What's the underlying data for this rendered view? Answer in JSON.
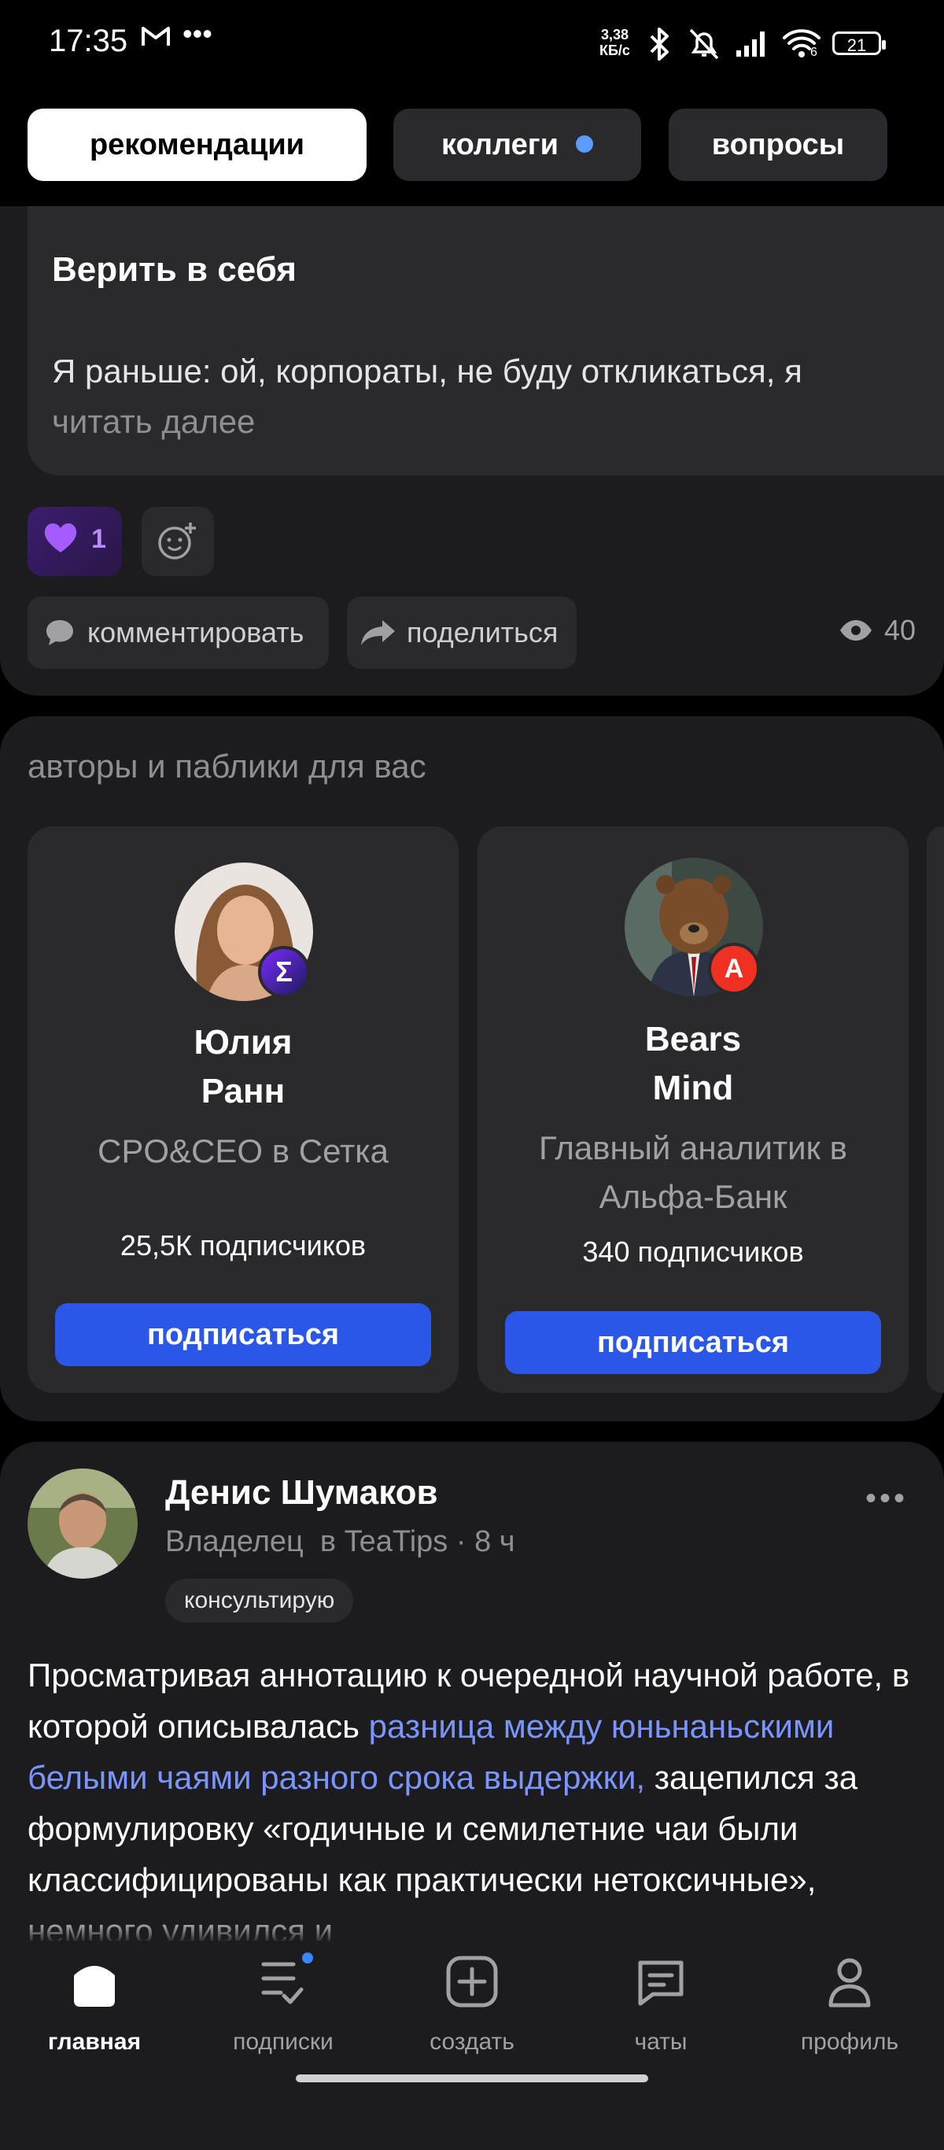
{
  "status_bar": {
    "time": "17:35",
    "net_speed_value": "3,38",
    "net_speed_unit": "КБ/с",
    "battery": "21",
    "signal_label": "6"
  },
  "tabs": [
    {
      "label": "рекомендации",
      "active": true
    },
    {
      "label": "коллеги",
      "has_dot": true
    },
    {
      "label": "вопросы"
    }
  ],
  "post1": {
    "title": "Верить в себя",
    "text": "Я раньше: ой, корпораты, не буду откликаться, я",
    "read_more": "читать далее",
    "reaction_count": "1",
    "comment_label": "комментировать",
    "share_label": "поделиться",
    "views": "40"
  },
  "authors": {
    "section_title": "авторы и паблики для вас",
    "cards": [
      {
        "name_line1": "Юлия",
        "name_line2": "Ранн",
        "role_line1": "CPO&CEO в Сетка",
        "role_line2": "",
        "subscribers": "25,5К подписчиков",
        "button": "подписаться",
        "badge": "Σ"
      },
      {
        "name_line1": "Bears",
        "name_line2": "Mind",
        "role_line1": "Главный аналитик в",
        "role_line2": "Альфа-Банк",
        "subscribers": "340 подписчиков",
        "button": "подписаться",
        "badge": "А"
      }
    ]
  },
  "post2": {
    "author": "Денис Шумаков",
    "role": "Владелец",
    "company": "в TeaTips",
    "time": "· 8 ч",
    "tag": "консультирую",
    "text_before_link": "Просматривая аннотацию к очередной научной работе, в которой описывалась ",
    "link_text": "разница между юньнаньскими белыми чаями разного срока выдержки,",
    "text_after_link": " зацепился за формулировку «годичные и семилетние чаи были классифицированы как практически нетоксичные», немного удивился и"
  },
  "nav": [
    {
      "label": "главная",
      "icon": "home-icon",
      "active": true
    },
    {
      "label": "подписки",
      "icon": "subscriptions-icon",
      "dot": true
    },
    {
      "label": "создать",
      "icon": "create-icon"
    },
    {
      "label": "чаты",
      "icon": "chat-icon"
    },
    {
      "label": "профиль",
      "icon": "profile-icon"
    }
  ],
  "colors": {
    "background": "#000000",
    "card": "#1c1c1e",
    "surface": "#2a2a2c",
    "accent": "#2b57e8",
    "link": "#7a95ff",
    "dot": "#5b9cff"
  }
}
